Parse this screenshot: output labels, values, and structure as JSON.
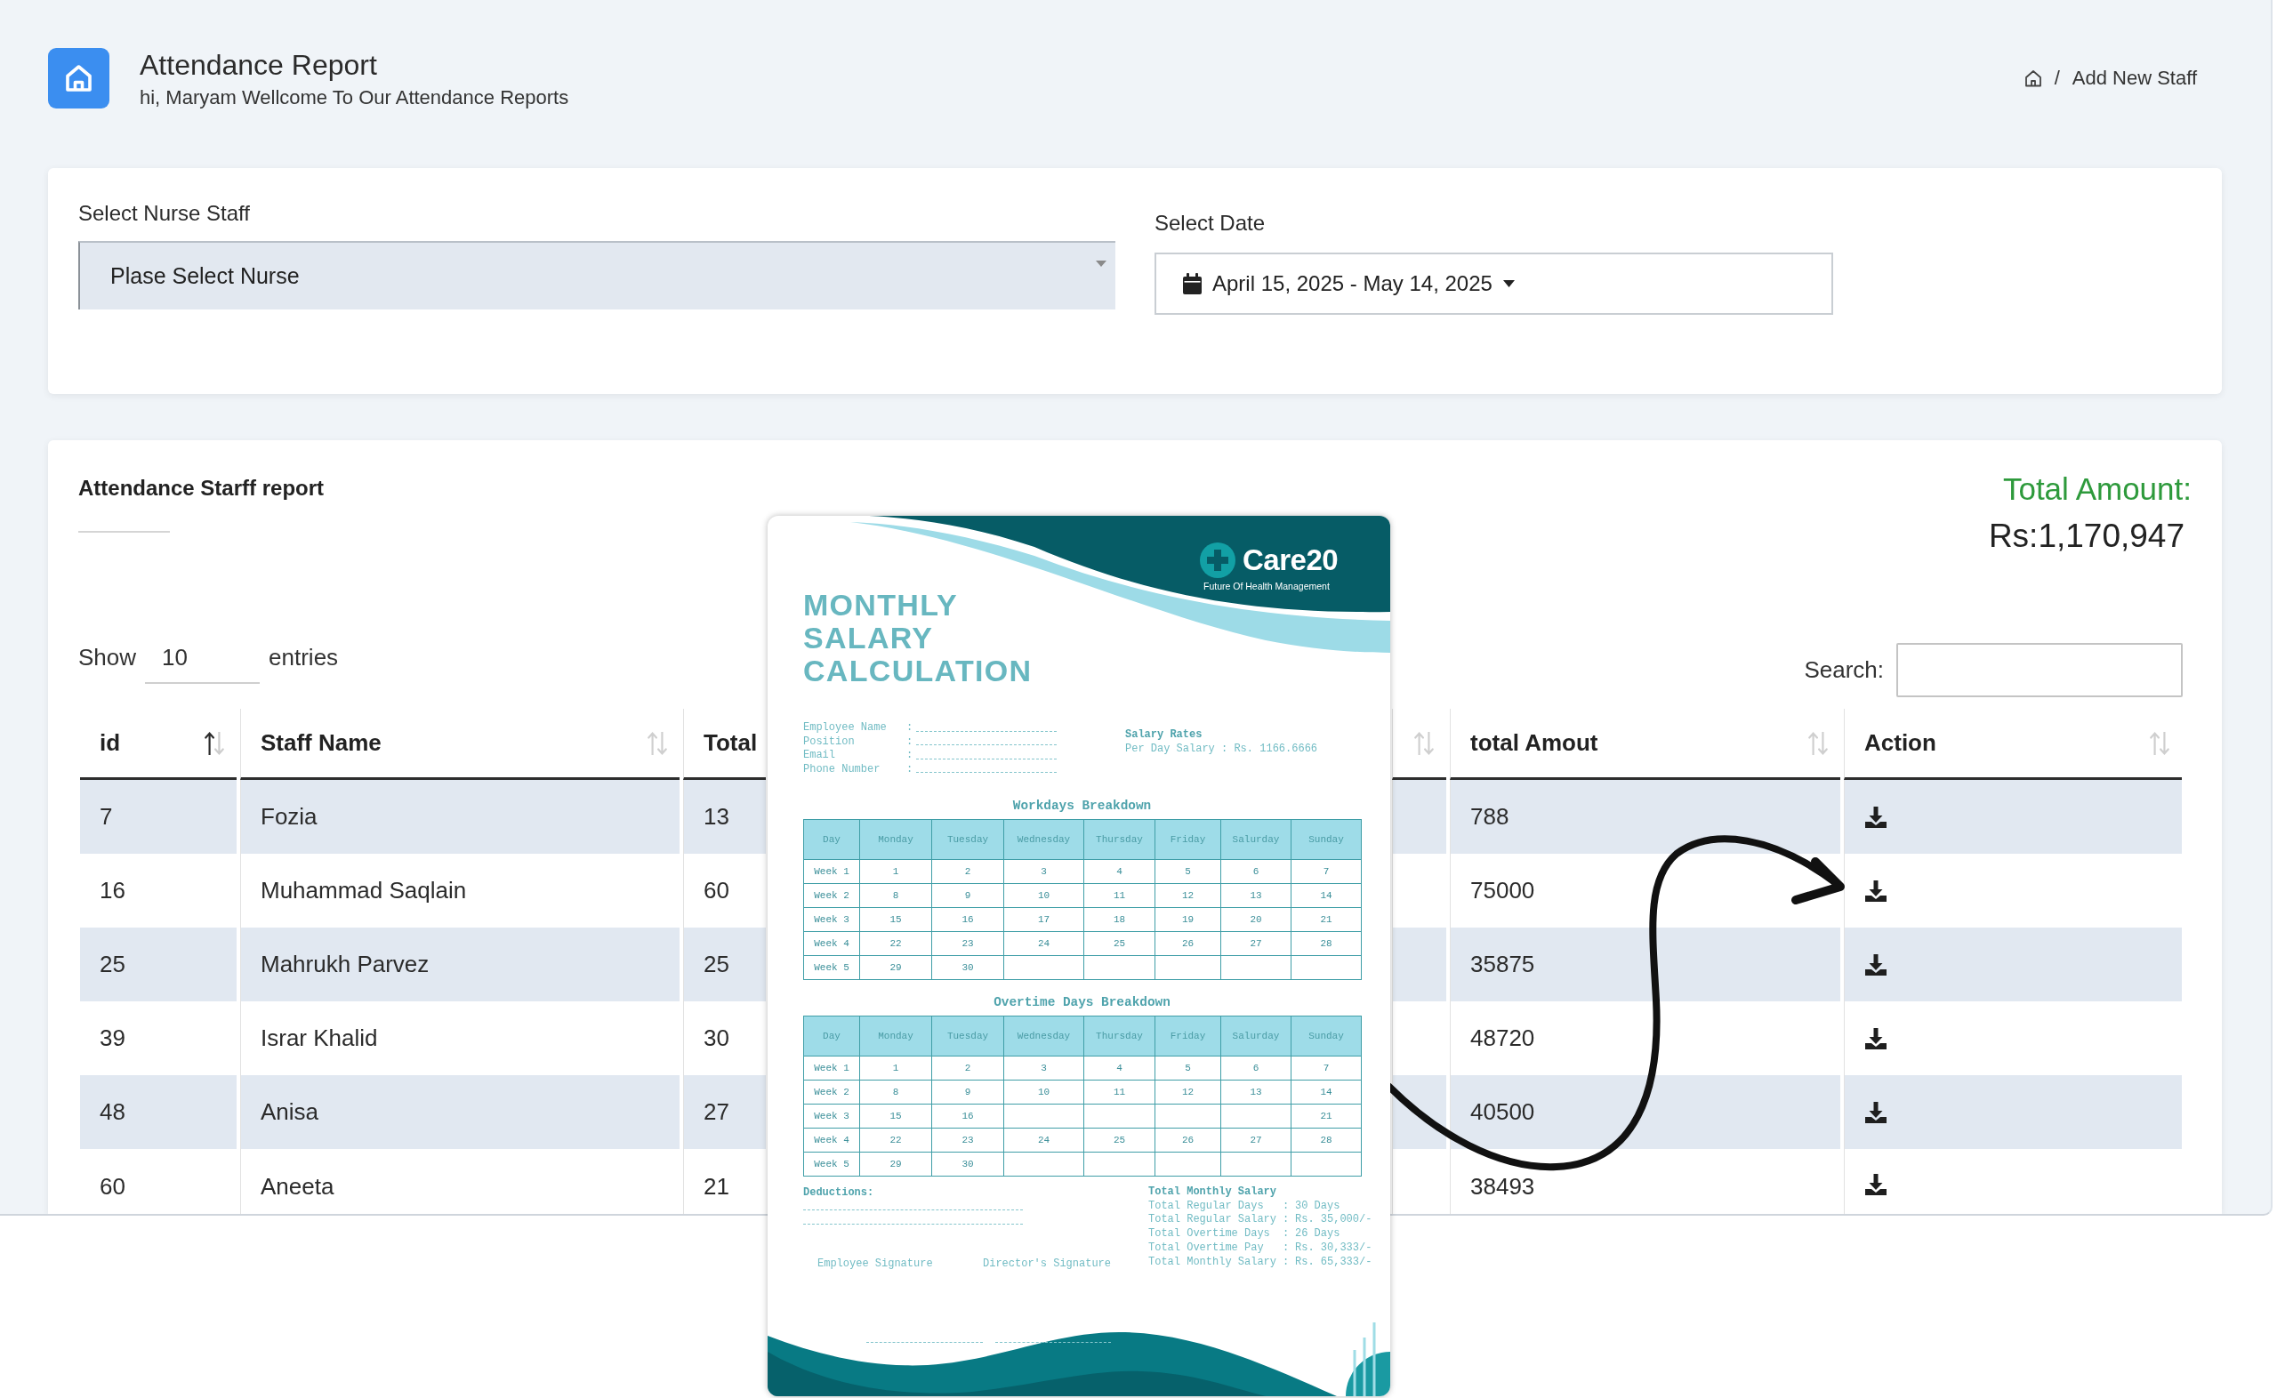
{
  "header": {
    "title": "Attendance Report",
    "subtitle": "hi, Maryam Wellcome To Our Attendance Reports",
    "breadcrumb": {
      "separator": "/",
      "current": "Add New Staff"
    }
  },
  "filters": {
    "nurse": {
      "label": "Select Nurse Staff",
      "value": "Plase Select Nurse"
    },
    "date": {
      "label": "Select Date",
      "value": "April 15, 2025 - May 14, 2025"
    }
  },
  "report": {
    "title": "Attendance Starff report",
    "total_label": "Total Amount:",
    "total_value": "Rs:1,170,947",
    "length": {
      "label_before": "Show",
      "value": "10",
      "label_after": "entries"
    },
    "search": {
      "label": "Search:"
    },
    "table": {
      "columns": [
        {
          "kind": "text",
          "label": "id",
          "sorted_asc": true
        },
        {
          "kind": "text",
          "label": "Staff Name",
          "sorted_asc": false
        },
        {
          "kind": "text",
          "label": "Total"
        },
        {
          "kind": "text",
          "sorted_asc": false
        },
        {
          "kind": "text",
          "label": "total Amout",
          "sorted_asc": false
        },
        {
          "kind": "action",
          "label": "Action",
          "sorted_asc": false
        }
      ],
      "rows": [
        [
          "7",
          "Fozia",
          "13",
          null,
          "788"
        ],
        [
          "16",
          "Muhammad Saqlain",
          "60",
          null,
          "75000"
        ],
        [
          "25",
          "Mahrukh Parvez",
          "25",
          null,
          "35875"
        ],
        [
          "39",
          "Israr Khalid",
          "30",
          null,
          "48720"
        ],
        [
          "48",
          "Anisa",
          "27",
          null,
          "40500"
        ],
        [
          "60",
          "Aneeta",
          "21",
          null,
          "38493"
        ]
      ]
    }
  },
  "document": {
    "brand": "Care20",
    "tagline": "Future Of Health Management",
    "title": "MONTHLY SALARY CALCULATION",
    "fields": [
      {
        "label": "Employee Name",
        "separator": ":",
        "blank": true
      },
      {
        "label": "Position",
        "separator": ":",
        "blank": true
      },
      {
        "label": "Email",
        "separator": ":",
        "blank": true
      },
      {
        "label": "Phone Number",
        "separator": ":",
        "blank": true
      }
    ],
    "rates": {
      "title": "Salary Rates",
      "lines": [
        "Per Day Salary : Rs. 1166.6666"
      ]
    },
    "tables": [
      {
        "title": "Workdays Breakdown",
        "columns": [
          "Day",
          "Monday",
          "Tuesday",
          "Wednesday",
          "Thursday",
          "Friday",
          "Salurday",
          "Sunday"
        ],
        "rows": [
          [
            "Week 1",
            "1",
            "2",
            "3",
            "4",
            "5",
            "6",
            "7"
          ],
          [
            "Week 2",
            "8",
            "9",
            "10",
            "11",
            "12",
            "13",
            "14"
          ],
          [
            "Week 3",
            "15",
            "16",
            "17",
            "18",
            "19",
            "20",
            "21"
          ],
          [
            "Week 4",
            "22",
            "23",
            "24",
            "25",
            "26",
            "27",
            "28"
          ],
          [
            "Week 5",
            "29",
            "30",
            null,
            null,
            null,
            null,
            null
          ]
        ]
      },
      {
        "title": "Overtime Days Breakdown",
        "columns": [
          "Day",
          "Monday",
          "Tuesday",
          "Wednesday",
          "Thursday",
          "Friday",
          "Salurday",
          "Sunday"
        ],
        "rows": [
          [
            "Week 1",
            "1",
            "2",
            "3",
            "4",
            "5",
            "6",
            "7"
          ],
          [
            "Week 2",
            "8",
            "9",
            "10",
            "11",
            "12",
            "13",
            "14"
          ],
          [
            "Week 3",
            "15",
            "16",
            null,
            null,
            null,
            null,
            "21"
          ],
          [
            "Week 4",
            "22",
            "23",
            "24",
            "25",
            "26",
            "27",
            "28"
          ],
          [
            "Week 5",
            "29",
            "30",
            null,
            null,
            null,
            null,
            null
          ]
        ]
      }
    ],
    "deductions": {
      "title": "Deductions:",
      "blanks": [
        {
          "kind": "dashed"
        },
        {
          "kind": "dashed"
        }
      ]
    },
    "signatures": [
      {
        "label": "Employee Signature",
        "blank": true
      },
      {
        "label": "Director's Signature",
        "blank": true
      }
    ],
    "totals": {
      "title": "Total Monthly Salary",
      "lines": [
        {
          "label": "Total Regular Days",
          "separator": ":",
          "value": "30 Days"
        },
        {
          "label": "Total Regular Salary",
          "separator": ":",
          "value": "Rs. 35,000/-"
        },
        {
          "label": "Total Overtime Days",
          "separator": ":",
          "value": "26 Days"
        },
        {
          "label": "Total Overtime Pay",
          "separator": ":",
          "value": "Rs. 30,333/-"
        },
        {
          "label": "Total Monthly Salary",
          "separator": ":",
          "value": "Rs. 65,333/-"
        }
      ]
    }
  }
}
